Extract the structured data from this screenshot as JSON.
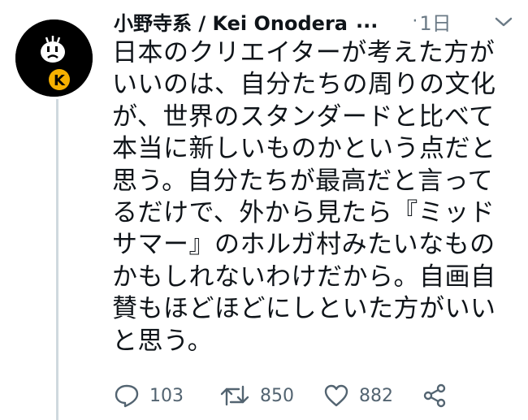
{
  "tweet": {
    "author_name": "小野寺系 / Kei Onodera",
    "name_truncation": "...",
    "separator": "·",
    "timestamp": "1日",
    "text_lines": [
      "日本のクリエイターが考えた方が",
      "いいのは、自分たちの周りの文化",
      "が、世界のスタンダードと比べて",
      "本当に新しいものかという点だと",
      "思う。自分たちが最高だと言って",
      "るだけで、外から見たら『ミッド",
      "サマー』のホルガ村みたいなもの",
      "かもしれないわけだから。自画自",
      "賛もほどほどにしといた方がいい",
      "と思う。"
    ]
  },
  "actions": {
    "reply_count": "103",
    "retweet_count": "850",
    "like_count": "882"
  },
  "icons": {
    "avatar": "k-mascot-avatar",
    "menu": "chevron-down-icon",
    "reply": "reply-icon",
    "retweet": "retweet-icon",
    "like": "heart-icon",
    "share": "share-icon"
  },
  "colors": {
    "text": "#0f1419",
    "secondary": "#536471",
    "thread_line": "#cfd9de",
    "avatar_accent": "#f5b000"
  }
}
